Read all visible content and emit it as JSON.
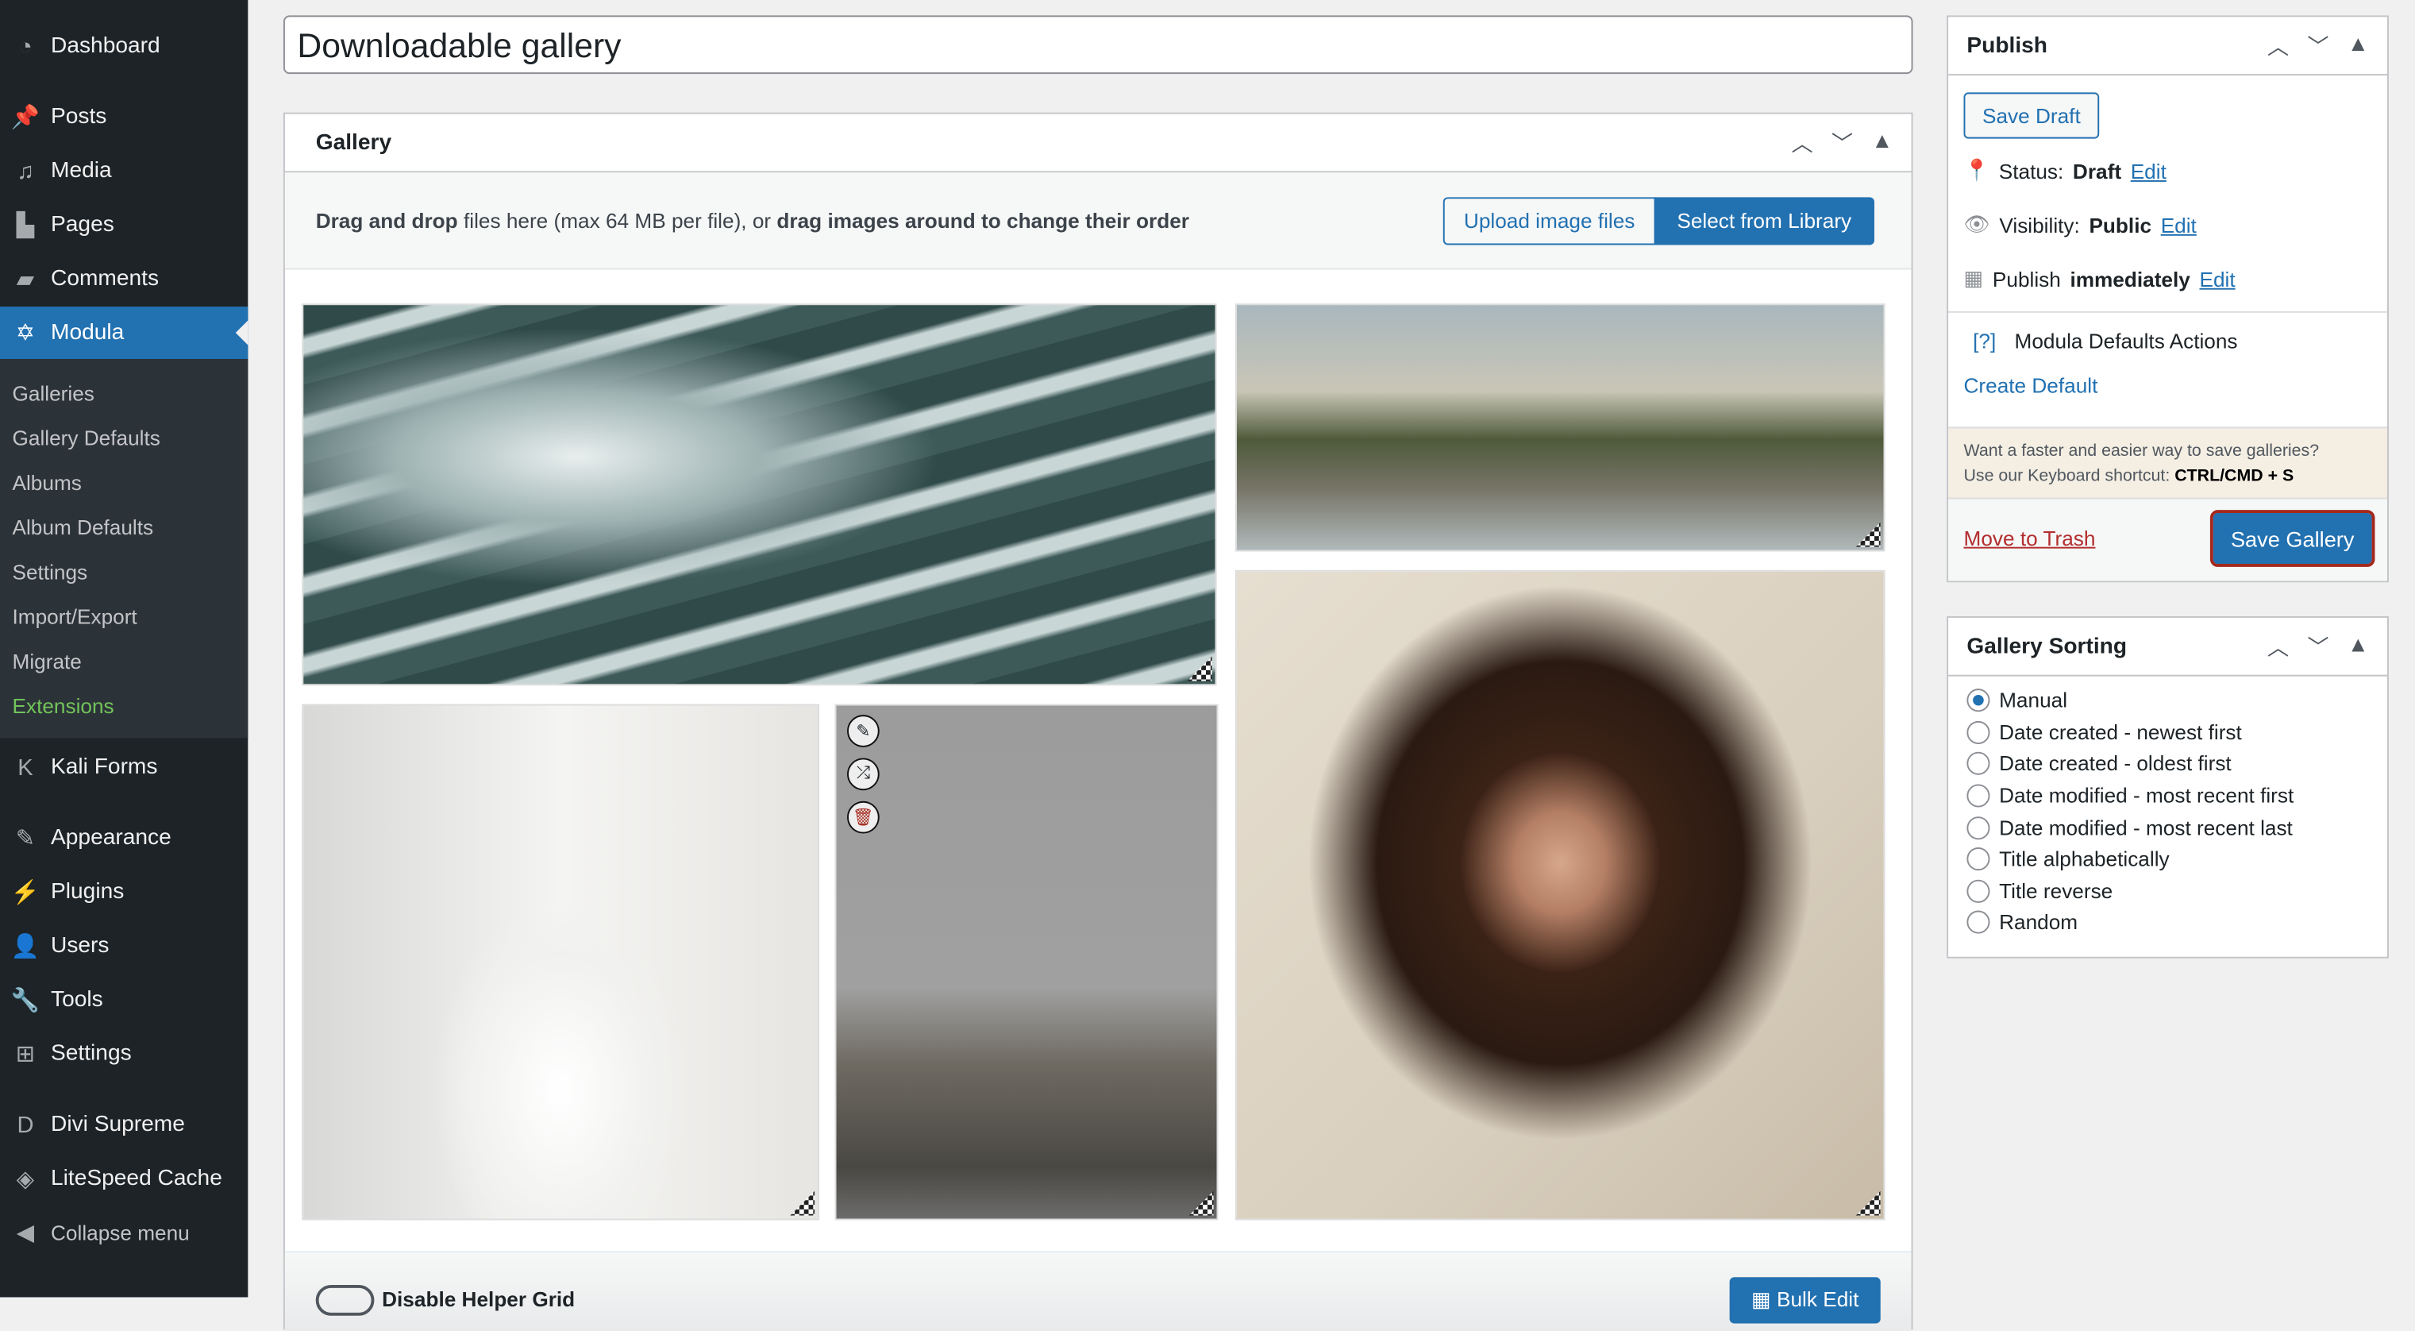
{
  "sidebar": {
    "items": [
      {
        "label": "Dashboard",
        "icon": "dashboard-icon"
      },
      {
        "label": "Posts",
        "icon": "pin-icon"
      },
      {
        "label": "Media",
        "icon": "media-icon"
      },
      {
        "label": "Pages",
        "icon": "pages-icon"
      },
      {
        "label": "Comments",
        "icon": "comment-icon"
      },
      {
        "label": "Modula",
        "icon": "modula-icon",
        "active": true
      },
      {
        "label": "Kali Forms",
        "icon": "kali-forms-icon"
      },
      {
        "label": "Appearance",
        "icon": "brush-icon"
      },
      {
        "label": "Plugins",
        "icon": "plugin-icon"
      },
      {
        "label": "Users",
        "icon": "user-icon"
      },
      {
        "label": "Tools",
        "icon": "wrench-icon"
      },
      {
        "label": "Settings",
        "icon": "settings-icon"
      },
      {
        "label": "Divi Supreme",
        "icon": "divi-icon"
      },
      {
        "label": "LiteSpeed Cache",
        "icon": "litespeed-icon"
      },
      {
        "label": "Collapse menu",
        "icon": "collapse-icon"
      }
    ],
    "submenu": [
      "Galleries",
      "Gallery Defaults",
      "Albums",
      "Album Defaults",
      "Settings",
      "Import/Export",
      "Migrate",
      "Extensions"
    ]
  },
  "title": "Downloadable gallery",
  "gallery": {
    "heading": "Gallery",
    "drop_bold1": "Drag and drop",
    "drop_text1": " files here (max 64 MB per file), or ",
    "drop_bold2": "drag images around to change their order",
    "upload_label": "Upload image files",
    "library_label": "Select from Library",
    "helper_grid_label": "Disable Helper Grid",
    "bulk_edit_label": "Bulk Edit"
  },
  "publish": {
    "heading": "Publish",
    "save_draft": "Save Draft",
    "status_label": "Status:",
    "status_value": "Draft",
    "visibility_label": "Visibility:",
    "visibility_value": "Public",
    "publish_label": "Publish",
    "publish_value": "immediately",
    "edit": "Edit",
    "defaults_help": "[?]",
    "defaults_label": "Modula Defaults Actions",
    "create_default": "Create Default",
    "tip_line1": "Want a faster and easier way to save galleries?",
    "tip_line2": "Use our Keyboard shortcut:",
    "tip_shortcut": "CTRL/CMD + S",
    "trash": "Move to Trash",
    "save_gallery": "Save Gallery"
  },
  "sorting": {
    "heading": "Gallery Sorting",
    "options": [
      "Manual",
      "Date created - newest first",
      "Date created - oldest first",
      "Date modified - most recent first",
      "Date modified - most recent last",
      "Title alphabetically",
      "Title reverse",
      "Random"
    ],
    "selected": "Manual"
  },
  "colors": {
    "accent": "#2271b1",
    "sidebar": "#1d2327",
    "danger": "#b32d2e",
    "extensions": "#72c35a"
  }
}
